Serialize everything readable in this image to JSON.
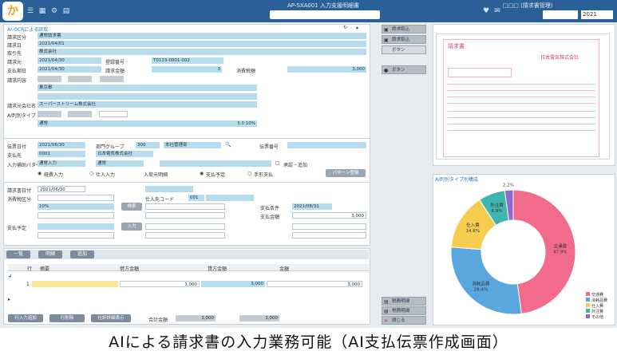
{
  "header": {
    "logo_glyph": "か",
    "title": "AP-SXA001 入力支援明細書",
    "user": "□□□ (請求書管理)",
    "year_select": "2021"
  },
  "sidebar_buttons": [
    "請求取込",
    "請求取込",
    "ボタン",
    "ボタン"
  ],
  "sidebar_bottom_buttons": [
    "税務明細",
    "税務明細",
    "閉じる"
  ],
  "form": {
    "section1_title": "AI-OCRによる読取",
    "rows": [
      {
        "label": "請求区分",
        "value": "通常請求書"
      },
      {
        "label": "請求日",
        "value": "2021/04/01"
      },
      {
        "label": "取引先",
        "value": "株式会社"
      },
      {
        "label": "請求元",
        "value": "2021/04/30"
      },
      {
        "label": "支払期日",
        "value": "2021/04/30"
      },
      {
        "label": "請求内容",
        "value": ""
      }
    ],
    "field_misc": {
      "registration_label": "登録番号",
      "registration_value": "T0123-0001-002",
      "amount_label": "請求金額",
      "amount_value": "3",
      "tax_label": "消費税額",
      "total_value": "3,000",
      "rate_value": "5.0 10%",
      "supplier_label": "請求元会社名",
      "supplier_value": "スーパーストリーム株式会社",
      "address_value": "東京都",
      "ai_label": "AI判別タイプ",
      "ai_value": "通常"
    },
    "section2": {
      "date_label": "伝票日付",
      "date_value": "2021/06/30",
      "dept_label": "部門グループ",
      "dept_value": "300",
      "dept_name": "本社管理部",
      "slip_label": "伝票番号",
      "payee_label": "支払先",
      "payee_value": "0001",
      "payee_name": "日本電気株式会社",
      "pattern_label": "入力補助パターン",
      "pattern_value": "通常入力",
      "pattern_extra": "通常",
      "radio1": "経費入力",
      "radio2": "仕入入力",
      "radio3": "入荷元明細",
      "radio4": "支払予定",
      "radio5": "手形支払",
      "check_label": "承認・追加",
      "action_button": "パターン登録"
    },
    "section3": {
      "date_label": "請求書日付",
      "date_value": "2021/06/30",
      "code_label": "仕入先コード",
      "code_value": "001",
      "tax_label": "消費税区分",
      "tax_value": "10%",
      "period_label": "支払条件",
      "period_value": "2021/08/31",
      "amount_label": "支払金額",
      "amount_value": "3,000",
      "out_label": "支払予定",
      "button1": "検索",
      "button2": "入力"
    },
    "grid": {
      "tabs": [
        "一覧",
        "明細",
        "追加"
      ],
      "columns": [
        "行",
        "摘要",
        "借方金額",
        "貸方金額",
        "金額"
      ],
      "row_index": "1",
      "row_amount1": "3,000",
      "row_amount2": "3,000",
      "row_amount3": "3,000"
    },
    "footer_buttons": [
      "行入力追加",
      "行削除",
      "仕訳詳細表示"
    ],
    "footer_total_label": "合計金額",
    "footer_total_value": "3,000",
    "footer_total2_value": "3,000"
  },
  "document_preview": {
    "title": "請求書",
    "company": "日本電気株式会社"
  },
  "chart_data": {
    "type": "pie",
    "title": "AI判別タイプ別構成",
    "categories": [
      "交通費",
      "消耗品費",
      "仕入費",
      "外注費",
      "その他"
    ],
    "values": [
      47.9,
      28.4,
      14.6,
      6.9,
      2.2
    ],
    "colors": [
      "#f26b8a",
      "#5aa7e0",
      "#f7cd4f",
      "#3db6b0",
      "#8c6bd0"
    ],
    "labels": [
      "交通費\n47.9%",
      "消耗品費\n28.4%",
      "仕入費\n14.6%",
      "外注費\n6.9%",
      "その他\n2.2%"
    ],
    "legend_position": "bottom-right"
  },
  "caption": "AIによる請求書の入力業務可能（AI支払伝票作成画面）"
}
